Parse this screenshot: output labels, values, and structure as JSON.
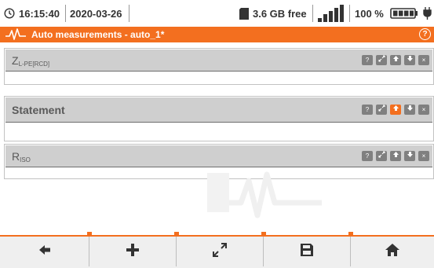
{
  "status": {
    "time": "16:15:40",
    "date": "2020-03-26",
    "storage": "3.6 GB free",
    "battery": "100 %"
  },
  "header": {
    "title": "Auto measurements - auto_1*",
    "accent": "#f36f1f"
  },
  "measurements": [
    {
      "label_main": "Z",
      "label_sub": "L-PE[RCD]"
    },
    {
      "label_main": "Statement",
      "label_sub": ""
    },
    {
      "label_main": "R",
      "label_sub": "ISO"
    }
  ],
  "item_buttons": {
    "help_icon": "?",
    "expand_icon": "expand-icon",
    "up_icon": "arrow-up-icon",
    "down_icon": "arrow-down-icon",
    "delete_icon": "×"
  },
  "toolbar": {
    "back_icon": "arrow-left-icon",
    "add_icon": "plus-icon",
    "expand_icon": "expand-icon",
    "save_icon": "save-icon",
    "home_icon": "home-icon"
  }
}
